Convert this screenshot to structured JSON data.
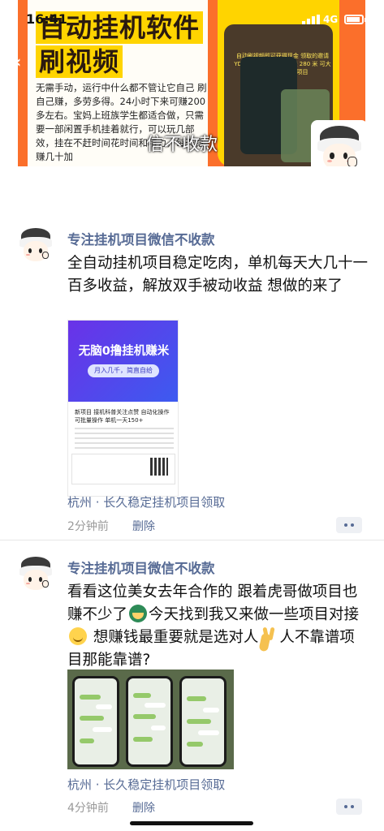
{
  "status_bar": {
    "time": "16:41",
    "network": "4G"
  },
  "cover": {
    "title_line1": "自动挂机软件",
    "title_line2": "刷视频",
    "description": "无需手动，运行中什么都不管让它自己 刷自己赚，多劳多得。24小时下来可赚200多左右。宝妈上班族学生都适合做，只需要一部闲置手机挂着就行，可以玩几部效，挂在不赶时间花时间和精力，每天稳赚几十加",
    "phone_text": "自动刷视频即可获得现金 领取的邀请 YDCM194 跨一天最少赚 280 米 可大批量，创业刷金项目",
    "overlay_text": "信不收款"
  },
  "posts": [
    {
      "author": "专注挂机项目微信不收款",
      "content": "全自动挂机项目稳定吃肉，单机每天大几十一百多收益，解放双手被动收益  想做的来了",
      "image": {
        "title": "无脑0撸挂机赚米",
        "pill": "月入几千，简直自给",
        "text": "新项目 接机科普关注点赞 自动化操作 可批量操作 单机一天150+"
      },
      "location": "杭州 · 长久稳定挂机项目领取",
      "time": "2分钟前",
      "delete_label": "删除"
    },
    {
      "author": "专注挂机项目微信不收款",
      "content_part1": "看看这位美女去年合作的  跟着虎哥做项目也赚不少了",
      "content_part2": "今天找到我又来做一些项目对接",
      "content_part3": " 想赚钱最重要就是选对人",
      "content_part4": "人不靠谱项目那能靠谱?",
      "location": "杭州 · 长久稳定挂机项目领取",
      "time": "4分钟前",
      "delete_label": "删除"
    }
  ],
  "icons": {
    "more": "more-dots-icon",
    "back": "back-arrow-icon",
    "emoji_soldier": "soldier-emoji-icon",
    "emoji_shy": "shy-emoji-icon",
    "emoji_victory": "victory-hand-emoji-icon"
  },
  "colors": {
    "link": "#576b95",
    "cover_orange": "#fb6f2b",
    "cover_yellow": "#ffd400"
  }
}
